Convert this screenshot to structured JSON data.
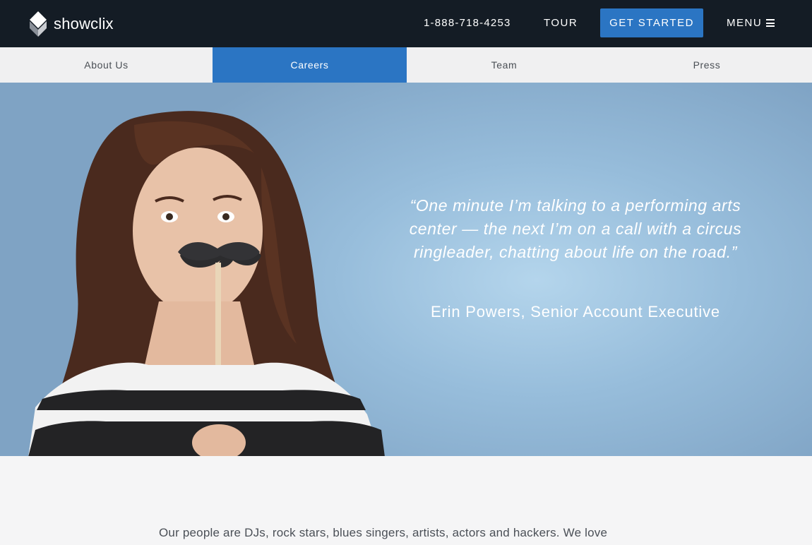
{
  "brand": {
    "logo_light": "show",
    "logo_bold": "clix"
  },
  "topnav": {
    "phone": "1-888-718-4253",
    "tour": "TOUR",
    "cta": "GET STARTED",
    "menu": "MENU",
    "menu_icon": "hamburger-icon"
  },
  "subnav": {
    "tabs": [
      {
        "label": "About Us",
        "active": false
      },
      {
        "label": "Careers",
        "active": true
      },
      {
        "label": "Team",
        "active": false
      },
      {
        "label": "Press",
        "active": false
      }
    ]
  },
  "hero": {
    "quote": "“One minute I’m talking to a performing arts center — the next I’m on a call with a circus ringleader, chatting about life on the road.”",
    "attribution": "Erin Powers, Senior Account Executive"
  },
  "content": {
    "intro": "Our people are DJs, rock stars, blues singers, artists, actors and hackers. We love"
  },
  "colors": {
    "navbar": "#141c25",
    "accent": "#2b75c3",
    "hero_bg": "#97bddb",
    "body_bg": "#f5f5f6"
  }
}
